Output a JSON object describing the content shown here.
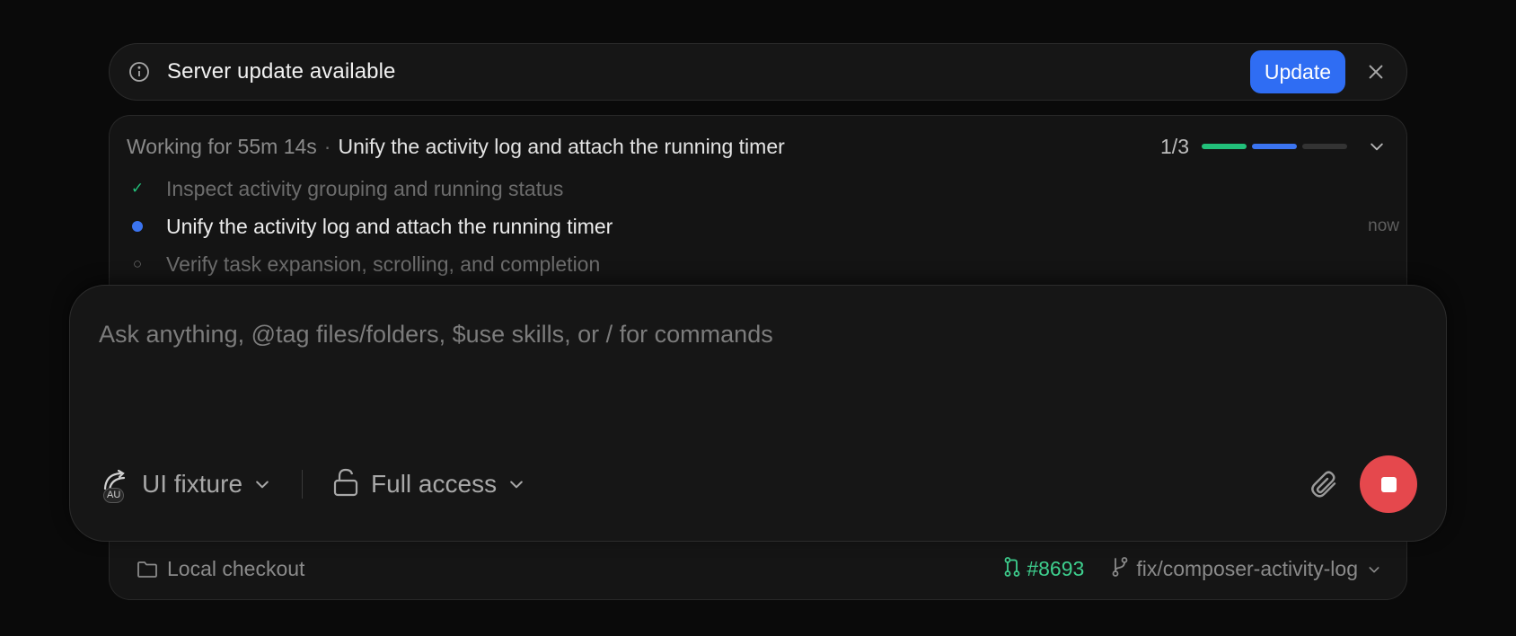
{
  "banner": {
    "title": "Server update available",
    "update_label": "Update"
  },
  "activity": {
    "working": "Working for 55m 14s",
    "separator": "·",
    "current_title": "Unify the activity log and attach the running timer",
    "progress": "1/3",
    "progress_fraction": 0.333,
    "steps": [
      {
        "status": "done",
        "label": "Inspect activity grouping and running status",
        "marker": "✓"
      },
      {
        "status": "current",
        "label": "Unify the activity log and attach the running timer",
        "time": "now"
      },
      {
        "status": "pending",
        "label": "Verify task expansion, scrolling, and completion",
        "marker": "○"
      }
    ]
  },
  "composer": {
    "placeholder": "Ask anything, @tag files/folders, $use skills, or / for commands",
    "model_badge": "AU",
    "model_label": "UI fixture",
    "access_label": "Full access"
  },
  "footer": {
    "checkout_label": "Local checkout",
    "pr_label": "#8693",
    "branch_label": "fix/composer-activity-log"
  },
  "colors": {
    "accent": "#2f6df3",
    "success": "#3ecf8e",
    "danger": "#e5484d",
    "bar_done": "#22c07a",
    "bar_active": "#3b74f0",
    "bar_pending": "#333333"
  }
}
